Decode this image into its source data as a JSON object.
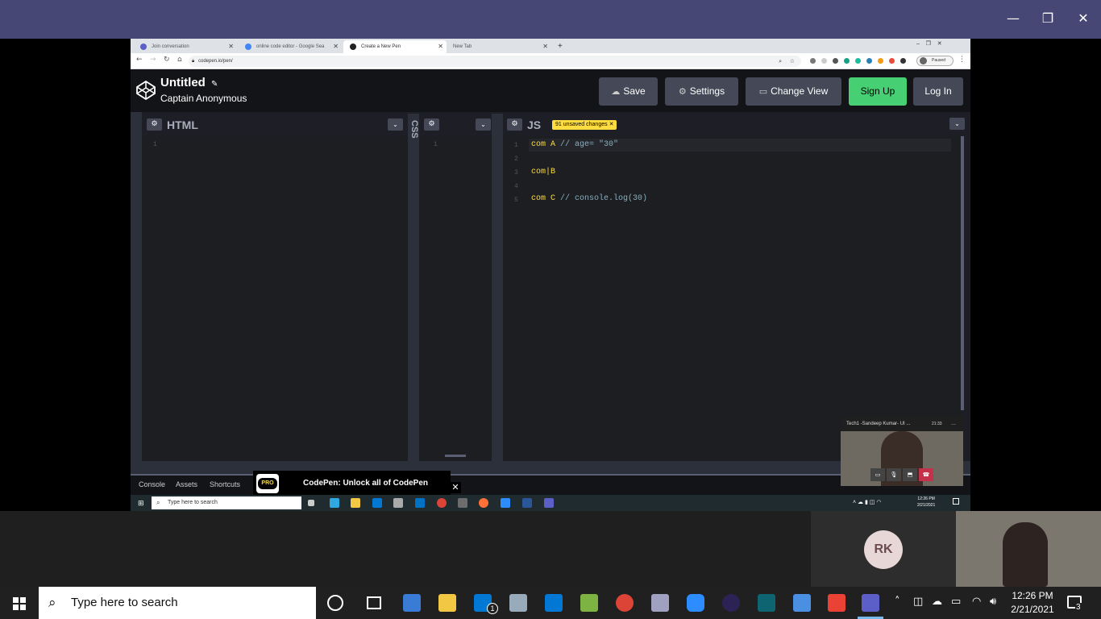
{
  "window_controls": {
    "minimize": "—",
    "restore": "❐",
    "close": "✕"
  },
  "browser": {
    "tabs": [
      {
        "label": "Join conversation",
        "icon_color": "#5b5fc7"
      },
      {
        "label": "online code editor - Google Sea",
        "icon_color": "#4285f4"
      },
      {
        "label": "Create a New Pen",
        "icon_color": "#222222"
      },
      {
        "label": "New Tab",
        "icon_color": "#dee1e6"
      }
    ],
    "new_tab": "+",
    "url": "codepen.io/pen/",
    "profile_status": "Paused"
  },
  "codepen": {
    "title": "Untitled",
    "author": "Captain Anonymous",
    "buttons": {
      "save": "Save",
      "settings": "Settings",
      "change_view": "Change View",
      "sign_up": "Sign Up",
      "log_in": "Log In"
    },
    "editors": {
      "html": {
        "label": "HTML",
        "lines": [
          "1"
        ]
      },
      "css": {
        "label": "CSS",
        "lines": [
          "1"
        ]
      },
      "js": {
        "label": "JS",
        "unsaved_badge": "91 unsaved changes",
        "line_numbers": [
          "1",
          "2",
          "3",
          "4",
          "5"
        ],
        "code": [
          {
            "code": "com A ",
            "comment": "// age= \"30\""
          },
          {
            "code": "",
            "comment": ""
          },
          {
            "code": "com|B",
            "comment": ""
          },
          {
            "code": "",
            "comment": ""
          },
          {
            "code": "com C ",
            "comment": "// console.log(30)"
          }
        ]
      }
    },
    "bottom_tabs": [
      "Console",
      "Assets",
      "Shortcuts"
    ],
    "pro_badge": "PRO",
    "pro_text": "CodePen: Unlock all of CodePen",
    "accent_colors": {
      "signup": "#47cf73",
      "badge": "#ffdd40"
    }
  },
  "inner_taskbar": {
    "search_placeholder": "Type here to search",
    "time": "12:26 PM",
    "date": "2/21/2021"
  },
  "teams": {
    "mini_title": "Tech1 -Sandeep Kumar- UI ...",
    "mini_timer": "21:33",
    "participant_initials": "RK"
  },
  "taskbar": {
    "search_placeholder": "Type here to search",
    "time": "12:26 PM",
    "date": "2/21/2021",
    "mail_badge": "1",
    "notification_count": "3"
  }
}
